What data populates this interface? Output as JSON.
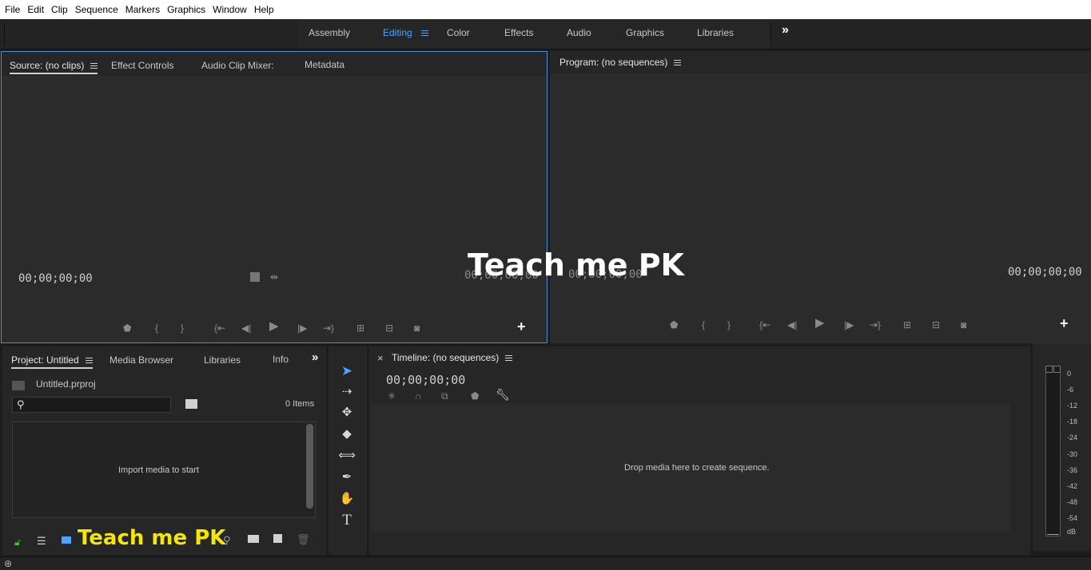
{
  "menu": [
    "File",
    "Edit",
    "Clip",
    "Sequence",
    "Markers",
    "Graphics",
    "Window",
    "Help"
  ],
  "workspaces": {
    "tabs": [
      "Assembly",
      "Editing",
      "Color",
      "Effects",
      "Audio",
      "Graphics",
      "Libraries"
    ],
    "active": "Editing",
    "overflow_icon": "double-chevron-right"
  },
  "source_panel": {
    "tabs": [
      "Source: (no clips)",
      "Effect Controls",
      "Audio Clip Mixer:",
      "Metadata"
    ],
    "timecode_left": "00;00;00;00",
    "timecode_right": "00;00;00;00",
    "controls": [
      "marker-icon",
      "mark-in-icon",
      "mark-out-icon",
      "go-to-in-icon",
      "step-back-icon",
      "play-icon",
      "step-forward-icon",
      "go-to-out-icon",
      "insert-icon",
      "overwrite-icon",
      "camera-icon"
    ],
    "add_label": "+"
  },
  "program_panel": {
    "tab": "Program: (no sequences)",
    "timecode_left": "00;00;00;00",
    "timecode_right": "00;00;00;00",
    "add_label": "+"
  },
  "project_panel": {
    "tabs": [
      "Project: Untitled",
      "Media Browser",
      "Libraries",
      "Info"
    ],
    "file_name": "Untitled.prproj",
    "search_placeholder": "",
    "items_count": "0 Items",
    "empty_message": "Import media to start"
  },
  "tools": [
    "selection-tool-icon",
    "track-select-icon",
    "ripple-edit-icon",
    "razor-icon",
    "slip-icon",
    "pen-icon",
    "hand-icon",
    "type-icon"
  ],
  "tool_glyphs": {
    "type": "T"
  },
  "timeline_panel": {
    "close_label": "×",
    "tab": "Timeline: (no sequences)",
    "timecode": "00;00;00;00",
    "drop_message": "Drop media here to create sequence."
  },
  "audio_meter": {
    "ticks": [
      "0",
      "-6",
      "-12",
      "-18",
      "-24",
      "-30",
      "-36",
      "-42",
      "-48",
      "-54",
      "dB"
    ]
  },
  "watermarks": {
    "center": "Teach me PK",
    "bottom": "Teach me PK"
  },
  "colors": {
    "accent_blue": "#4fa3ff",
    "panel_bg": "#262626",
    "watermark_bottom": "#f5e60a"
  }
}
